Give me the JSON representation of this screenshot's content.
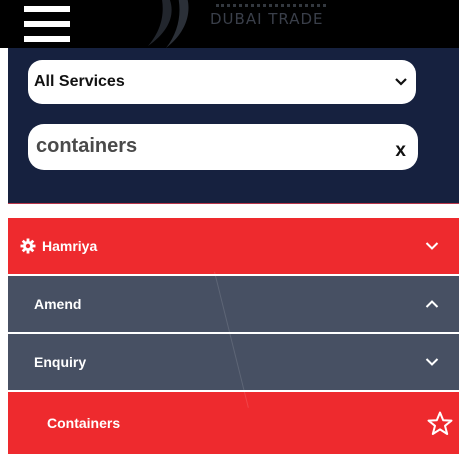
{
  "header": {
    "logo_text": "DUBAI TRADE"
  },
  "search": {
    "category_selected": "All Services",
    "query_value": "containers",
    "clear_label": "x"
  },
  "menu": {
    "items": [
      {
        "label": "Hamriya",
        "level": 0,
        "state": "collapsed",
        "icon": "gear-icon",
        "bg": "#ee2a2e"
      },
      {
        "label": "Amend",
        "level": 1,
        "state": "expanded",
        "bg": "#475063"
      },
      {
        "label": "Enquiry",
        "level": 1,
        "state": "collapsed",
        "bg": "#475063"
      },
      {
        "label": "Containers",
        "level": 2,
        "icon": "star-outline-icon",
        "bg": "#ee2a2e"
      }
    ]
  },
  "colors": {
    "topbar": "#000000",
    "panel": "#16213f",
    "accent_red": "#ee2a2e",
    "slate": "#475063"
  }
}
